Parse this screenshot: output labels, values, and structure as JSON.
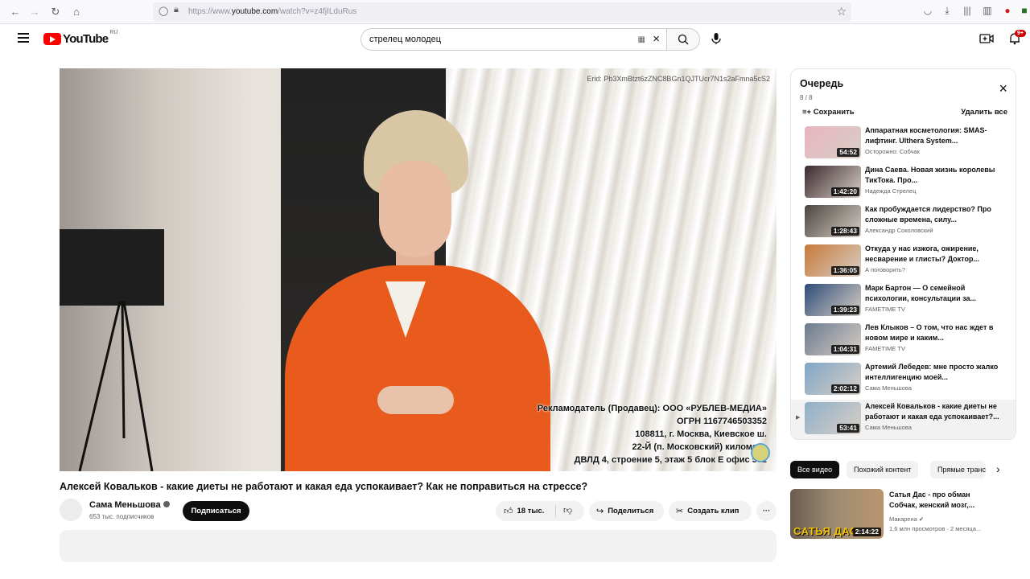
{
  "browser": {
    "url_prefix": "https://www.",
    "url_domain": "youtube.com",
    "url_path": "/watch?v=z4fjILduRus",
    "icons": [
      "back-icon",
      "forward-icon",
      "reload-icon",
      "home-icon",
      "shield-icon",
      "lock-icon",
      "bookmark-star-icon",
      "pocket-icon",
      "download-icon",
      "library-icon",
      "sidebar-icon",
      "extension-icon"
    ]
  },
  "header": {
    "logo_text": "YouTube",
    "logo_region": "RU",
    "search_value": "стрелец молодец",
    "notifications_badge": "9+"
  },
  "player": {
    "erid": "Erid:  Pb3XmBtzt6zZNC8BGn1QJTUcr7N1s2aFmna5cS2",
    "ad_lines": [
      "Рекламодатель (Продавец): ООО «РУБЛЕВ-МЕДИА»",
      "ОГРН 1167746503352",
      "108811, г. Москва, Киевское ш.",
      "22-Й (п. Московский) километр",
      "ДВЛД 4, строение 5, этаж 5 блок Е офис 502"
    ]
  },
  "video": {
    "title": "Алексей Ковальков - какие диеты не работают и какая еда успокаивает? Как не поправиться на стрессе?",
    "channel": "Сама Меньшова",
    "subscribers": "653 тыс. подписчиков",
    "subscribe_label": "Подписаться",
    "likes": "18 тыс.",
    "share_label": "Поделиться",
    "clip_label": "Создать клип",
    "more_label": "···"
  },
  "queue": {
    "title": "Очередь",
    "count": "8 / 8",
    "save_label": "Сохранить",
    "remove_all_label": "Удалить все",
    "items": [
      {
        "title": "Аппаратная косметология: SMAS-лифтинг. Ulthera System...",
        "channel": "Осторожно: Собчак",
        "duration": "54:52",
        "thumb_color": "#e8b4c0"
      },
      {
        "title": "Дина Саева. Новая жизнь королевы ТикТока. Про...",
        "channel": "Надежда Стрелец",
        "duration": "1:42:20",
        "thumb_color": "#3a2a2e"
      },
      {
        "title": "Как пробуждается лидерство? Про сложные времена, силу...",
        "channel": "Александр Соколовский",
        "duration": "1:28:43",
        "thumb_color": "#4a4540"
      },
      {
        "title": "Откуда у нас изжога, ожирение, несварение и глисты? Доктор...",
        "channel": "А поговорить?",
        "duration": "1:36:05",
        "thumb_color": "#c77a3a"
      },
      {
        "title": "Марк Бартон — О семейной психологии, консультации за...",
        "channel": "FAMETIME TV",
        "duration": "1:39:23",
        "thumb_color": "#2f4c78"
      },
      {
        "title": "Лев Клыков – О том, что нас ждет в новом мире и каким...",
        "channel": "FAMETIME TV",
        "duration": "1:04:31",
        "thumb_color": "#6b7a8e"
      },
      {
        "title": "Артемий Лебедев: мне просто жалко интеллигенцию моей...",
        "channel": "Сама Меньшова",
        "duration": "2:02:12",
        "thumb_color": "#7fa6c6"
      },
      {
        "title": "Алексей Ковальков - какие диеты не работают и какая еда успокаивает?...",
        "channel": "Сама Меньшова",
        "duration": "53:41",
        "thumb_color": "#8fb0c8"
      }
    ]
  },
  "chips": [
    "Все видео",
    "Похожий контент",
    "Прямые трансляции"
  ],
  "recommendation": {
    "title": "Сатья Дас - про обман Собчак, женский мозг,...",
    "channel": "Макарена",
    "meta": "1,6 млн просмотров · 2 месяца...",
    "duration": "2:14:22",
    "thumb_caption": "САТЬЯ ДАС"
  }
}
